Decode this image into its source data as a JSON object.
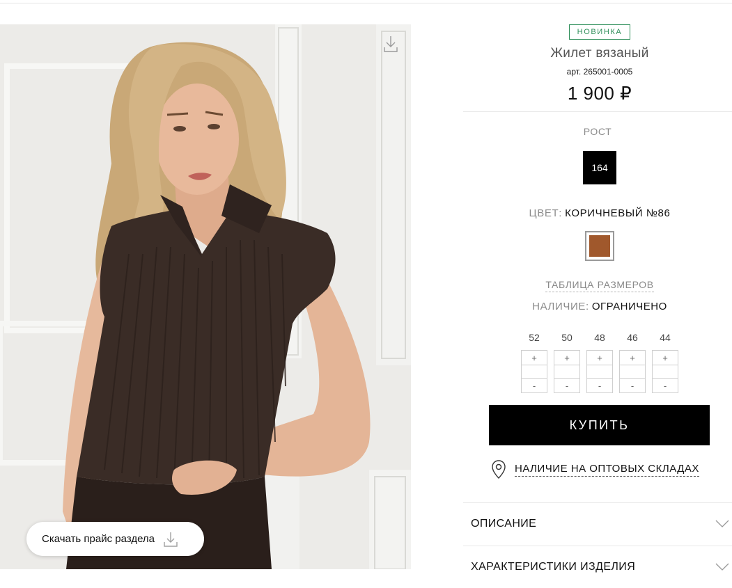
{
  "product": {
    "badge": "НОВИНКА",
    "title": "Жилет вязаный",
    "article": "арт. 265001-0005",
    "price": "1 900 ₽"
  },
  "options": {
    "height_label": "РОСТ",
    "height_value": "164",
    "color_label": "ЦВЕТ:",
    "color_value": "КОРИЧНЕВЫЙ №86",
    "color_hex": "#a0582c",
    "size_table_link": "ТАБЛИЦА РАЗМЕРОВ",
    "availability_label": "НАЛИЧИЕ:",
    "availability_value": "ОГРАНИЧЕНО"
  },
  "sizes": [
    {
      "size": "52",
      "plus": "+",
      "minus": "-"
    },
    {
      "size": "50",
      "plus": "+",
      "minus": "-"
    },
    {
      "size": "48",
      "plus": "+",
      "minus": "-"
    },
    {
      "size": "46",
      "plus": "+",
      "minus": "-"
    },
    {
      "size": "44",
      "plus": "+",
      "minus": "-"
    }
  ],
  "actions": {
    "buy_label": "КУПИТЬ",
    "warehouse_link": "НАЛИЧИЕ НА ОПТОВЫХ СКЛАДАХ",
    "download_price": "Скачать прайс раздела"
  },
  "accordion": [
    {
      "label": "ОПИСАНИЕ"
    },
    {
      "label": "ХАРАКТЕРИСТИКИ ИЗДЕЛИЯ"
    }
  ],
  "colors": {
    "badge_green": "#2f8f5a",
    "garment_brown": "#3a2c26"
  }
}
